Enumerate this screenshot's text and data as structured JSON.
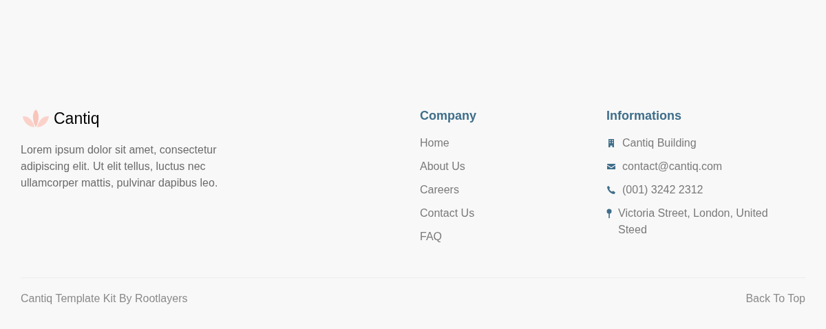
{
  "brand": {
    "name": "Cantiq",
    "description": "Lorem ipsum dolor sit amet, consectetur adipiscing elit. Ut elit tellus, luctus nec ullamcorper mattis, pulvinar dapibus leo."
  },
  "company": {
    "heading": "Company",
    "links": [
      "Home",
      "About Us",
      "Careers",
      "Contact Us",
      "FAQ"
    ]
  },
  "informations": {
    "heading": "Informations",
    "items": [
      {
        "kind": "building",
        "text": "Cantiq Building"
      },
      {
        "kind": "email",
        "text": "contact@cantiq.com"
      },
      {
        "kind": "phone",
        "text": "(001) 3242 2312"
      },
      {
        "kind": "location",
        "text": "Victoria Street, London, United Steed"
      }
    ]
  },
  "bottom_bar": {
    "credit": "Cantiq Template Kit By Rootlayers",
    "back_to_top": "Back To Top"
  }
}
